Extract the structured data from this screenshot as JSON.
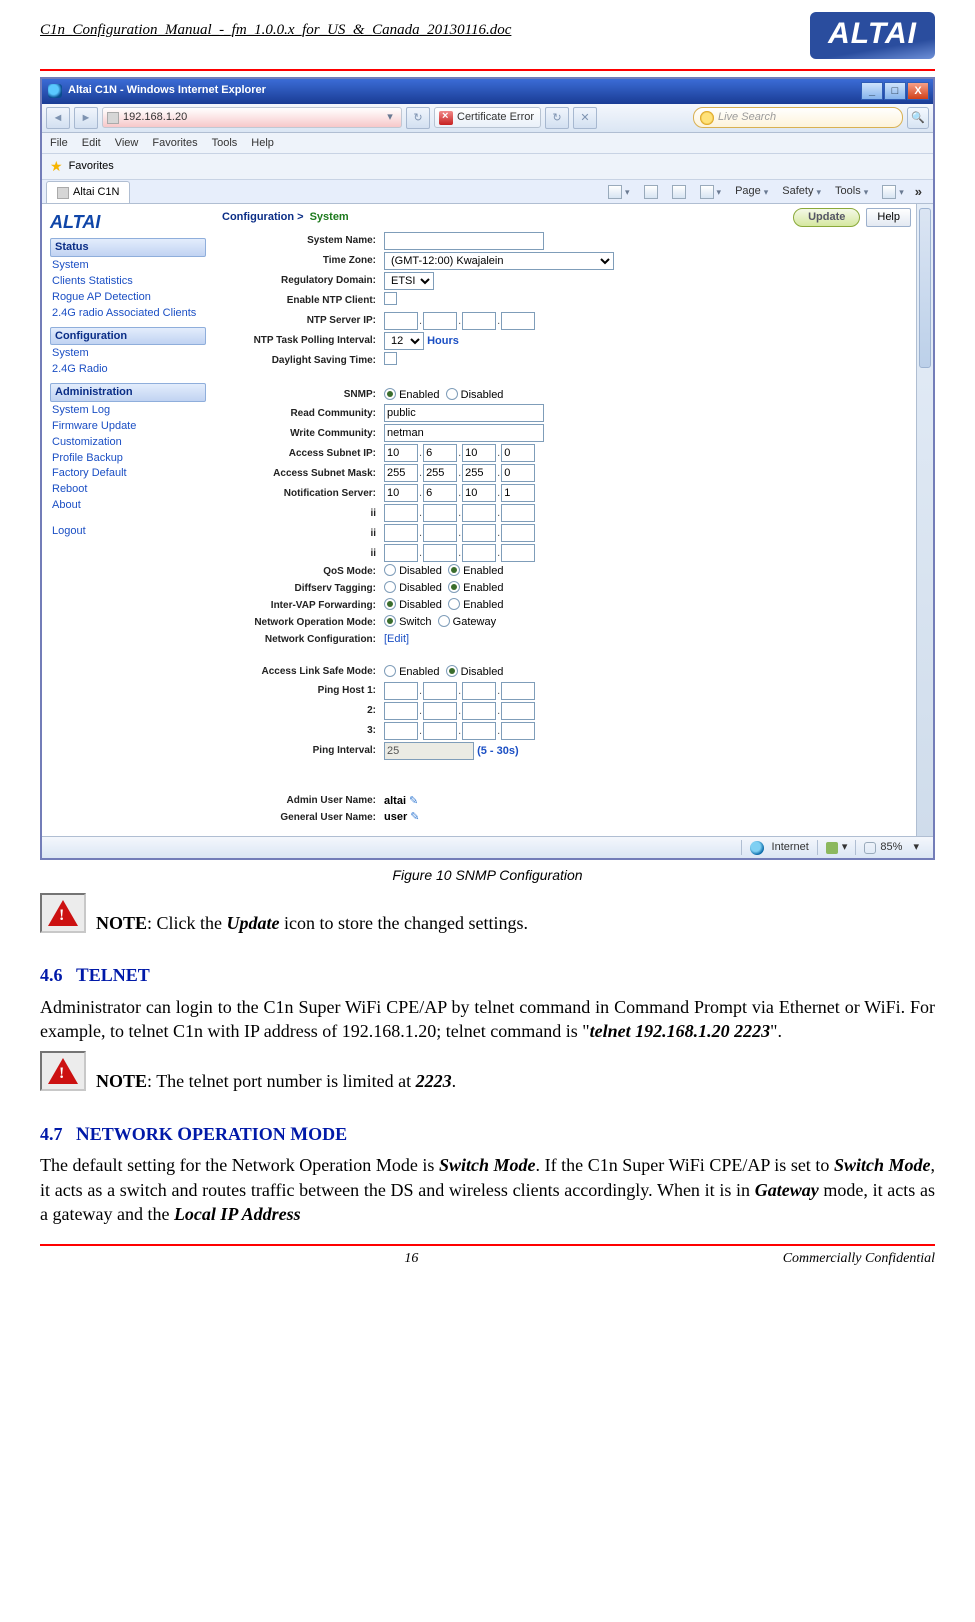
{
  "doc_header_title": "C1n_Configuration_Manual_-_fm_1.0.0.x_for_US_&_Canada_20130116.doc",
  "brand": "ALTAI",
  "ie": {
    "title": "Altai C1N - Windows Internet Explorer",
    "url": "192.168.1.20",
    "cert_error": "Certificate Error",
    "search_placeholder": "Live Search",
    "menus": [
      "File",
      "Edit",
      "View",
      "Favorites",
      "Tools",
      "Help"
    ],
    "favorites_label": "Favorites",
    "tab_label": "Altai C1N",
    "toolbar": {
      "page": "Page",
      "safety": "Safety",
      "tools": "Tools"
    },
    "status": {
      "zone": "Internet",
      "zoom": "85%"
    }
  },
  "nav": {
    "sections": [
      {
        "header": "Status",
        "items": [
          "System",
          "Clients Statistics",
          "Rogue AP Detection",
          "2.4G radio Associated Clients"
        ]
      },
      {
        "header": "Configuration",
        "items": [
          "System",
          "2.4G Radio"
        ]
      },
      {
        "header": "Administration",
        "items": [
          "System Log",
          "Firmware Update",
          "Customization",
          "Profile Backup",
          "Factory Default",
          "Reboot",
          "About"
        ]
      }
    ],
    "logout": "Logout"
  },
  "breadcrumb": {
    "a": "Configuration >",
    "b": "System"
  },
  "buttons": {
    "update": "Update",
    "help": "Help"
  },
  "form": {
    "system_name_label": "System Name:",
    "time_zone_label": "Time Zone:",
    "time_zone_value": "(GMT-12:00) Kwajalein",
    "reg_domain_label": "Regulatory Domain:",
    "reg_domain_value": "ETSI",
    "enable_ntp_label": "Enable NTP Client:",
    "ntp_server_ip_label": "NTP Server IP:",
    "ntp_polling_label": "NTP Task Polling Interval:",
    "ntp_polling_value": "12",
    "ntp_polling_unit": "Hours",
    "dst_label": "Daylight Saving Time:",
    "snmp_label": "SNMP:",
    "enabled": "Enabled",
    "disabled": "Disabled",
    "read_comm_label": "Read Community:",
    "read_comm": "public",
    "write_comm_label": "Write Community:",
    "write_comm": "netman",
    "access_subnet_ip_label": "Access Subnet IP:",
    "asip": [
      "10",
      "6",
      "10",
      "0"
    ],
    "access_subnet_mask_label": "Access Subnet Mask:",
    "asm": [
      "255",
      "255",
      "255",
      "0"
    ],
    "notif_label": "Notification Server:",
    "ns": [
      "10",
      "6",
      "10",
      "1"
    ],
    "row_ii": "ii",
    "qos_label": "QoS Mode:",
    "diffserv_label": "Diffserv Tagging:",
    "intervap_label": "Inter-VAP Forwarding:",
    "netop_label": "Network Operation Mode:",
    "switch": "Switch",
    "gateway": "Gateway",
    "netcfg_label": "Network Configuration:",
    "edit": "[Edit]",
    "als_label": "Access Link Safe Mode:",
    "ping1": "Ping Host 1:",
    "ping2": "2:",
    "ping3": "3:",
    "ping_int": "Ping Interval:",
    "ping_int_val": "25",
    "ping_int_range": "(5 - 30s)",
    "admin_label": "Admin User Name:",
    "admin": "altai",
    "gen_label": "General User Name:",
    "gen": "user"
  },
  "figure_caption": "Figure 10    SNMP Configuration",
  "note1_pre": "NOTE",
  "note1_body_a": ": Click the ",
  "note1_body_b": "Update",
  "note1_body_c": " icon to store the changed settings.",
  "s46_num": "4.6",
  "s46_title": "Telnet",
  "s46_para": {
    "a": "Administrator can login to the C1n Super WiFi CPE/AP by telnet command in Command Prompt via Ethernet or WiFi. For example, to telnet C1n with IP address of 192.168.1.20; telnet command is \"",
    "b": "telnet 192.168.1.20 2223",
    "c": "\"."
  },
  "note2_pre": "NOTE",
  "note2_body_a": ": The telnet port number is limited at ",
  "note2_body_b": "2223",
  "note2_body_c": ".",
  "s47_num": "4.7",
  "s47_title": "Network Operation Mode",
  "s47_para": {
    "a": "The default setting for the Network Operation Mode is ",
    "b": "Switch Mode",
    "c": ". If the C1n Super WiFi CPE/AP is set to ",
    "d": "Switch Mode",
    "e": ", it acts as a switch and routes traffic between the DS and wireless clients accordingly. When it is in ",
    "f": "Gateway",
    "g": " mode, it acts as a gateway and the ",
    "h": "Local IP Address"
  },
  "footer_page": "16",
  "footer_conf": "Commercially Confidential"
}
